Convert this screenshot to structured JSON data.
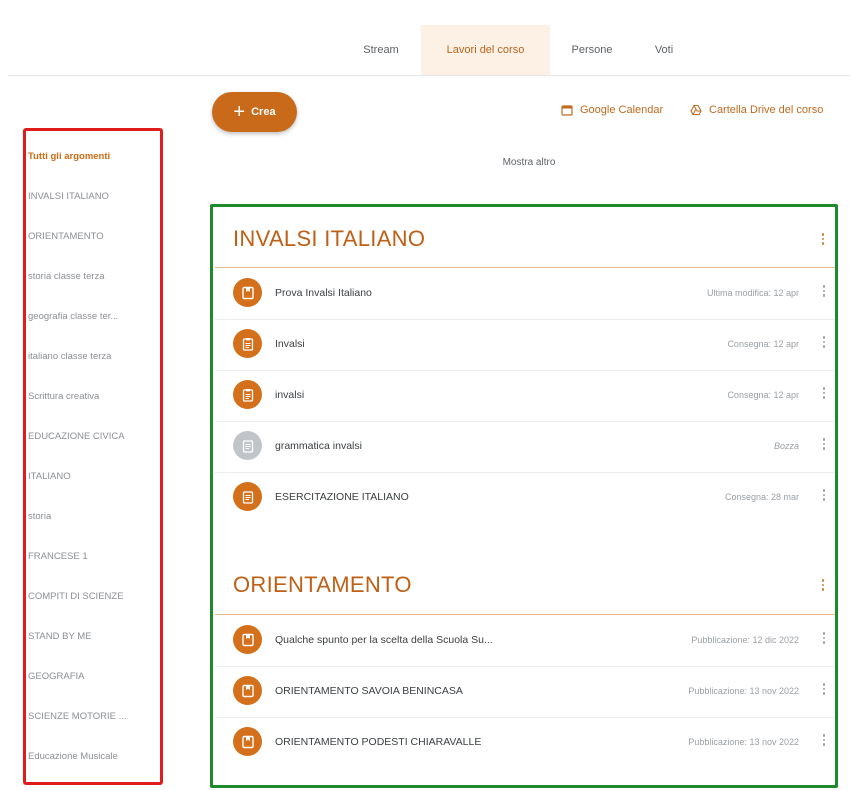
{
  "tabs": [
    {
      "label": "Stream"
    },
    {
      "label": "Lavori del corso",
      "active": true
    },
    {
      "label": "Persone"
    },
    {
      "label": "Voti"
    }
  ],
  "actions": {
    "create_label": "Crea",
    "calendar_label": "Google Calendar",
    "drive_label": "Cartella Drive del corso",
    "show_more_label": "Mostra altro"
  },
  "sidebar": {
    "items": [
      {
        "label": "Tutti gli argomenti",
        "active": true
      },
      {
        "label": "INVALSI ITALIANO"
      },
      {
        "label": "ORIENTAMENTO"
      },
      {
        "label": "storia classe terza"
      },
      {
        "label": "geografia classe ter..."
      },
      {
        "label": "italiano classe terza"
      },
      {
        "label": "Scrittura creativa"
      },
      {
        "label": "EDUCAZIONE CIVICA"
      },
      {
        "label": "ITALIANO"
      },
      {
        "label": "storia"
      },
      {
        "label": "FRANCESE 1"
      },
      {
        "label": "COMPITI DI SCIENZE"
      },
      {
        "label": "STAND BY ME"
      },
      {
        "label": "GEOGRAFIA"
      },
      {
        "label": "SCIENZE MOTORIE ..."
      },
      {
        "label": "Educazione Musicale"
      }
    ]
  },
  "topics": [
    {
      "title": "INVALSI ITALIANO",
      "items": [
        {
          "icon": "material-icon",
          "title": "Prova Invalsi Italiano",
          "meta": "Ultima modifica: 12 apr"
        },
        {
          "icon": "assignment-icon",
          "title": "Invalsi",
          "meta": "Consegna: 12 apr"
        },
        {
          "icon": "assignment-icon",
          "title": "invalsi",
          "meta": "Consegna: 12 apr"
        },
        {
          "icon": "draft-assignment-icon",
          "title": "grammatica invalsi",
          "meta": "Bozza",
          "draft": true
        },
        {
          "icon": "assignment-icon",
          "title": "ESERCITAZIONE ITALIANO",
          "meta": "Consegna: 28 mar"
        }
      ]
    },
    {
      "title": "ORIENTAMENTO",
      "items": [
        {
          "icon": "material-icon",
          "title": "Qualche spunto per la scelta della Scuola Su...",
          "meta": "Pubblicazione: 12 dic 2022"
        },
        {
          "icon": "material-icon",
          "title": "ORIENTAMENTO SAVOIA BENINCASA",
          "meta": "Pubblicazione: 13 nov 2022"
        },
        {
          "icon": "material-icon",
          "title": "ORIENTAMENTO PODESTI CHIARAVALLE",
          "meta": "Pubblicazione: 13 nov 2022"
        }
      ]
    }
  ],
  "colors": {
    "accent": "#c96a1a",
    "sidebar_highlight_box": "#e21b1b",
    "main_highlight_box": "#1d8a2c"
  }
}
